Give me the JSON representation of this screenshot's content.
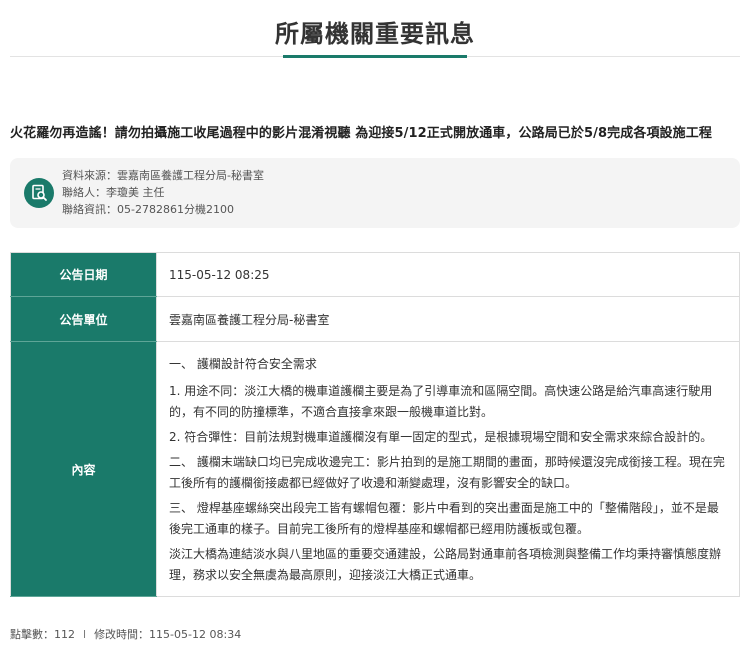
{
  "page": {
    "title": "所屬機關重要訊息",
    "headline": "火花羅勿再造謠！請勿拍攝施工收尾過程中的影片混淆視聽 為迎接5/12正式開放通車，公路局已於5/8完成各項設施工程"
  },
  "source": {
    "icon": "document-search-icon",
    "origin": "資料來源：雲嘉南區養護工程分局-秘書室",
    "contact": "聯絡人：李瓊美 主任",
    "phone": "聯絡資訊：05-2782861分機2100"
  },
  "table": {
    "date_label": "公告日期",
    "date_value": "115-05-12 08:25",
    "unit_label": "公告單位",
    "unit_value": "雲嘉南區養護工程分局-秘書室",
    "content_label": "內容",
    "content_paragraphs": [
      "一、 護欄設計符合安全需求",
      "1. 用途不同：淡江大橋的機車道護欄主要是為了引導車流和區隔空間。高快速公路是給汽車高速行駛用的，有不同的防撞標準，不適合直接拿來跟一般機車道比對。",
      "2. 符合彈性：目前法規對機車道護欄沒有單一固定的型式，是根據現場空間和安全需求來綜合設計的。",
      "二、 護欄末端缺口均已完成收邊完工：影片拍到的是施工期間的畫面，那時候還沒完成銜接工程。現在完工後所有的護欄銜接處都已經做好了收邊和漸變處理，沒有影響安全的缺口。",
      "三、 燈桿基座螺絲突出段完工皆有螺帽包覆：影片中看到的突出畫面是施工中的「整備階段」，並不是最後完工通車的樣子。目前完工後所有的燈桿基座和螺帽都已經用防護板或包覆。",
      "淡江大橋為連結淡水與八里地區的重要交通建設，公路局對通車前各項檢測與整備工作均秉持審慎態度辦理，務求以安全無虞為最高原則，迎接淡江大橋正式通車。"
    ]
  },
  "footer": {
    "clicks": "點擊數：112",
    "separator": "l",
    "modified": "修改時間：115-05-12 08:34"
  },
  "colors": {
    "accent": "#1a7a6a",
    "source_bg": "#f4f4f4"
  }
}
